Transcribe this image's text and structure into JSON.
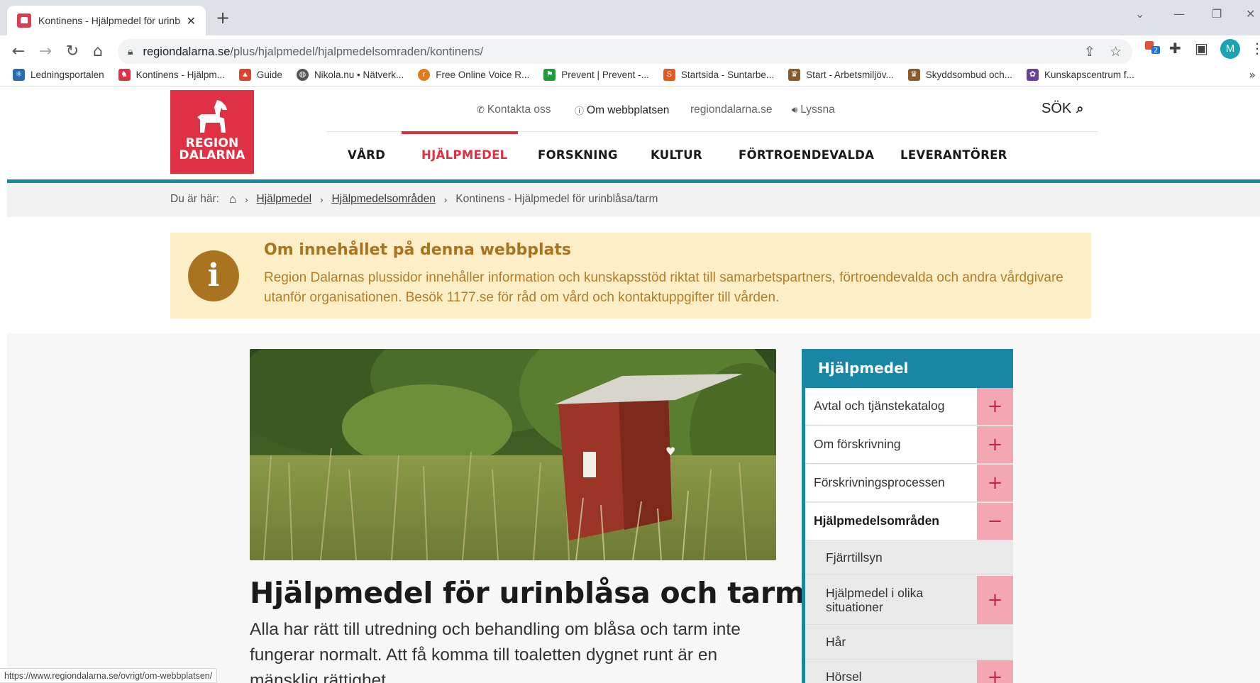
{
  "browser": {
    "tab_title": "Kontinens - Hjälpmedel för urinbl",
    "tab_close": "✕",
    "new_tab": "+",
    "url_host": "regiondalarna.se",
    "url_path": "/plus/hjalpmedel/hjalpmedelsomraden/kontinens/",
    "extension_badge": "2",
    "profile_initial": "M",
    "status_url": "https://www.regiondalarna.se/ovrigt/om-webbplatsen/",
    "bookmarks": [
      {
        "label": "Ledningsportalen",
        "icon": "atom-icon",
        "color": "#2b6cb0"
      },
      {
        "label": "Kontinens - Hjälpm...",
        "icon": "region-dalarna-icon",
        "color": "#e03144"
      },
      {
        "label": "Guide",
        "icon": "guide-icon",
        "color": "#d9452b"
      },
      {
        "label": "Nikola.nu • Nätverk...",
        "icon": "globe-icon",
        "color": "#555555"
      },
      {
        "label": "Free Online Voice R...",
        "icon": "voice-icon",
        "color": "#e07b1a"
      },
      {
        "label": "Prevent | Prevent -...",
        "icon": "flag-icon",
        "color": "#1e9c3a"
      },
      {
        "label": "Startsida - Suntarbe...",
        "icon": "suntarbe-icon",
        "color": "#e8561e"
      },
      {
        "label": "Start - Arbetsmiljöv...",
        "icon": "crown-icon",
        "color": "#8a5a2b"
      },
      {
        "label": "Skyddsombud och...",
        "icon": "crown-icon",
        "color": "#8a5a2b"
      },
      {
        "label": "Kunskapscentrum f...",
        "icon": "star-icon",
        "color": "#6a3fa0"
      }
    ]
  },
  "site": {
    "logo_line1": "REGION",
    "logo_line2": "DALARNA",
    "utility": {
      "contact": "Kontakta oss",
      "about": "Om webbplatsen",
      "main_site": "regiondalarna.se",
      "listen": "Lyssna",
      "search": "SÖK"
    },
    "nav": [
      "VÅRD",
      "HJÄLPMEDEL",
      "FORSKNING",
      "KULTUR",
      "FÖRTROENDEVALDA",
      "LEVERANTÖRER"
    ],
    "active_nav": "HJÄLPMEDEL",
    "breadcrumb": {
      "prefix": "Du är här:",
      "items": [
        "Hjälpmedel",
        "Hjälpmedelsområden"
      ],
      "current": "Kontinens - Hjälpmedel för urinblåsa/tarm"
    },
    "notice": {
      "title": "Om innehållet på denna webbplats",
      "text": "Region Dalarnas plussidor innehåller information och kunskapsstöd riktat till samarbetspartners, förtroendevalda och andra vårdgivare utanför organisationen. Besök 1177.se för råd om vård och kontaktuppgifter till vården."
    },
    "page_title": "Hjälpmedel för urinblåsa och tarm",
    "lead": "Alla har rätt till utredning och behandling om blåsa och tarm inte fungerar normalt. Att få komma till toaletten dygnet runt är en mänsklig rättighet.",
    "sidebar": {
      "heading": "Hjälpmedel",
      "items": [
        {
          "label": "Avtal och tjänstekatalog",
          "toggle": "+"
        },
        {
          "label": "Om förskrivning",
          "toggle": "+"
        },
        {
          "label": "Förskrivningsprocessen",
          "toggle": "+"
        },
        {
          "label": "Hjälpmedelsområden",
          "toggle": "−"
        },
        {
          "label": "Fjärrtillsyn",
          "toggle": ""
        },
        {
          "label": "Hjälpmedel i olika situationer",
          "toggle": "+"
        },
        {
          "label": "Hår",
          "toggle": ""
        },
        {
          "label": "Hörsel",
          "toggle": "+"
        }
      ]
    }
  }
}
